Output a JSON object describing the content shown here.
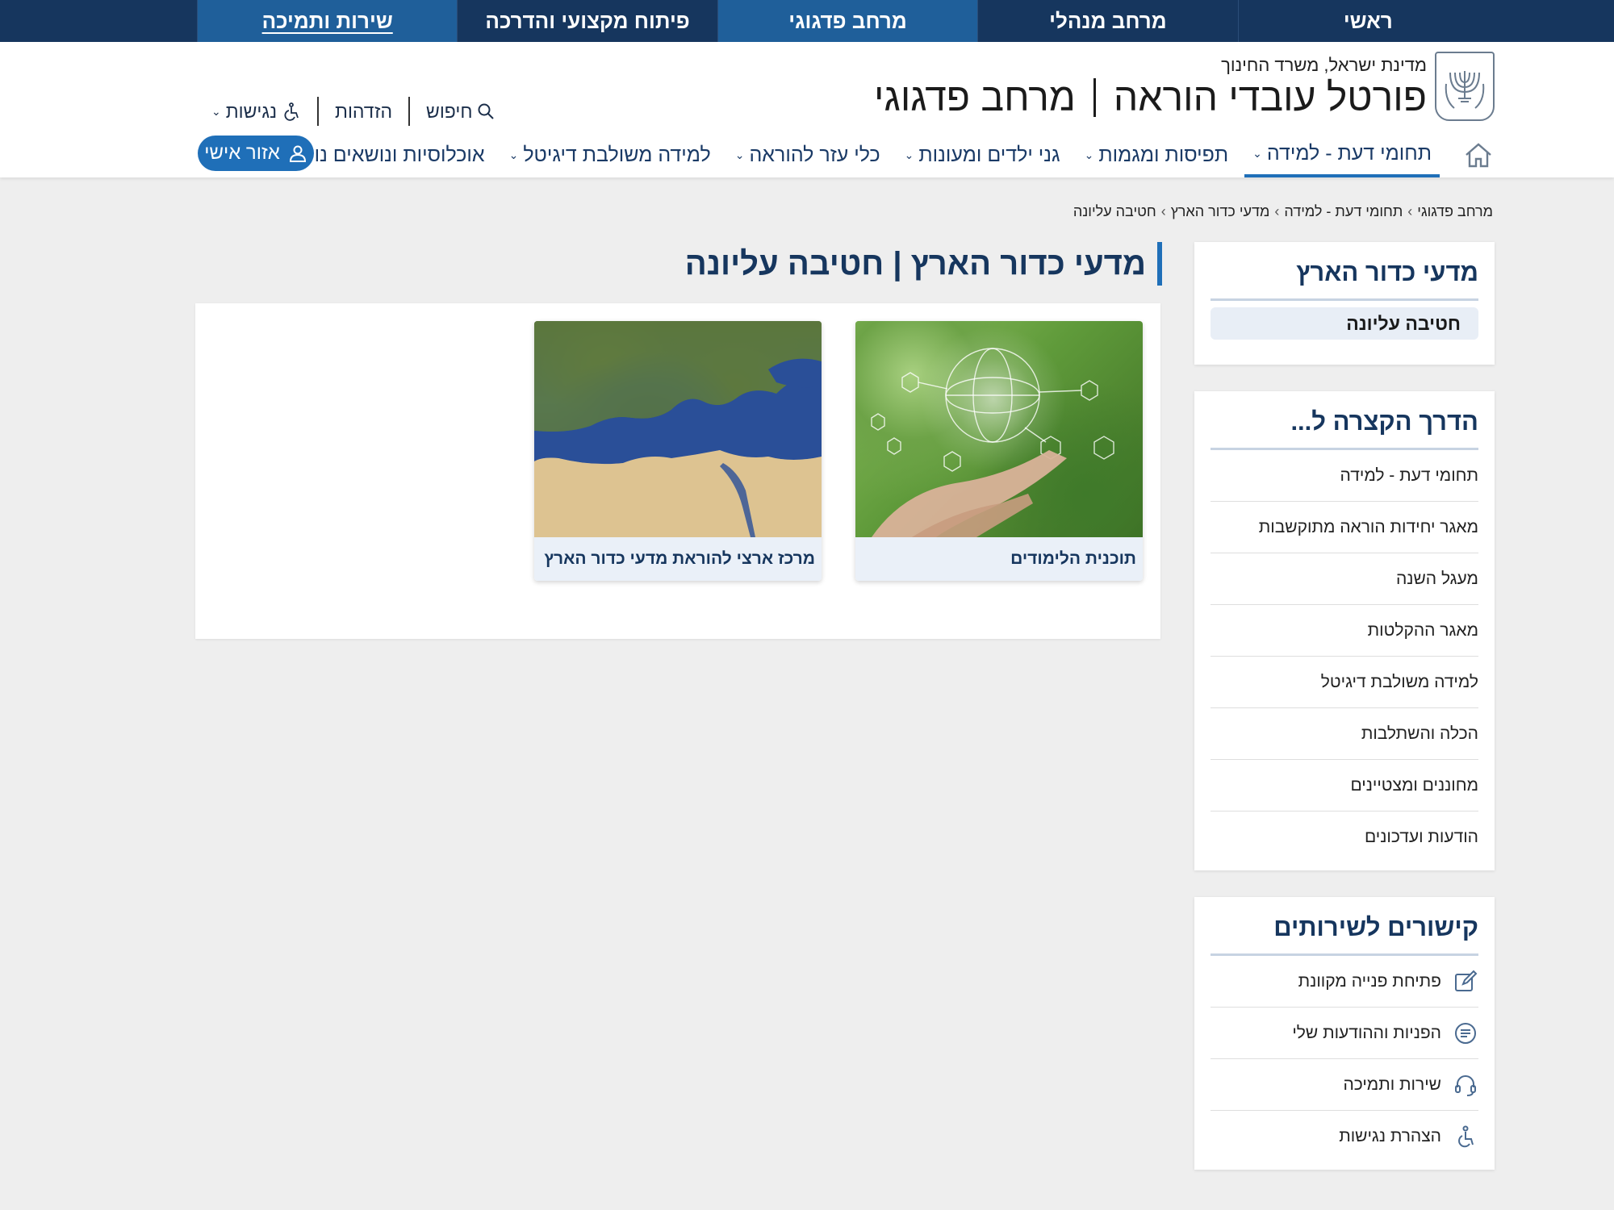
{
  "top_tabs": [
    {
      "label": "ראשי"
    },
    {
      "label": "מרחב מנהלי"
    },
    {
      "label": "מרחב פדגוגי"
    },
    {
      "label": "פיתוח מקצועי והדרכה"
    },
    {
      "label": "שירות ותמיכה"
    }
  ],
  "header": {
    "ministry": "מדינת ישראל, משרד החינוך",
    "portal_name": "פורטל עובדי הוראה",
    "portal_section": "מרחב פדגוגי"
  },
  "utility": {
    "search": "חיפוש",
    "login": "הזדהות",
    "accessibility": "נגישות"
  },
  "mainnav": {
    "items": [
      {
        "label": "תחומי דעת - למידה"
      },
      {
        "label": "תפיסות ומגמות"
      },
      {
        "label": "גני ילדים ומעונות"
      },
      {
        "label": "כלי עזר להוראה"
      },
      {
        "label": "למידה משולבת דיגיטל"
      },
      {
        "label": "אוכלוסיות ונושאים נוספים"
      }
    ],
    "personal_area": "אזור אישי"
  },
  "breadcrumb": [
    "מרחב פדגוגי",
    "תחומי דעת - למידה",
    "מדעי כדור הארץ",
    "חטיבה עליונה"
  ],
  "sidebar": {
    "section_title": "מדעי כדור הארץ",
    "section_active": "חטיבה עליונה",
    "shortcuts_title": "הדרך הקצרה ל...",
    "shortcuts": [
      "תחומי דעת - למידה",
      "מאגר יחידות הוראה מתוקשבות",
      "מעגל השנה",
      "מאגר ההקלטות",
      "למידה משולבת דיגיטל",
      "הכלה והשתלבות",
      "מחוננים ומצטיינים",
      "הודעות ועדכונים"
    ],
    "services_title": "קישורים לשירותים",
    "services": [
      {
        "label": "פתיחת פנייה מקוונת",
        "icon": "edit-icon"
      },
      {
        "label": "הפניות וההודעות שלי",
        "icon": "chat-icon"
      },
      {
        "label": "שירות ותמיכה",
        "icon": "headset-icon"
      },
      {
        "label": "הצהרת נגישות",
        "icon": "wheelchair-icon"
      }
    ]
  },
  "main": {
    "title": "מדעי כדור הארץ | חטיבה עליונה",
    "tiles": [
      {
        "caption": "תוכנית הלימודים",
        "image": "hands-globe-image"
      },
      {
        "caption": "מרכז ארצי להוראת מדעי כדור הארץ",
        "image": "satellite-map-image"
      }
    ]
  },
  "colors": {
    "navy": "#16365e",
    "accent_blue": "#1f6fb8",
    "background": "#eeeeee"
  }
}
